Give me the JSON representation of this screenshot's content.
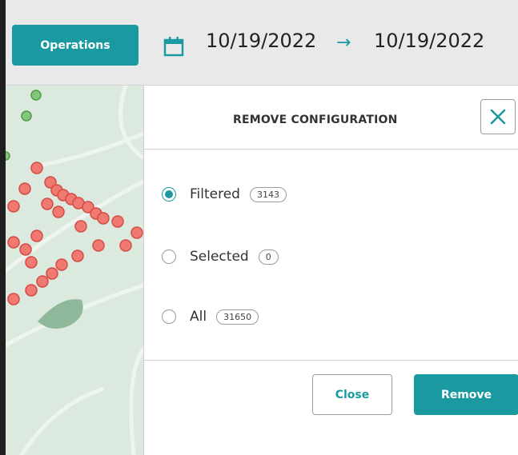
{
  "toolbar": {
    "operations_label": "Operations",
    "date_from": "10/19/2022",
    "date_arrow": "→",
    "date_to": "10/19/2022",
    "calendar_icon": "calendar-icon",
    "accent_color": "#1a9aa0"
  },
  "panel": {
    "title": "REMOVE CONFIGURATION",
    "close_icon": "close-icon",
    "options": [
      {
        "label": "Filtered",
        "count": "3143",
        "selected": true
      },
      {
        "label": "Selected",
        "count": "0",
        "selected": false
      },
      {
        "label": "All",
        "count": "31650",
        "selected": false
      }
    ],
    "close_label": "Close",
    "remove_label": "Remove"
  },
  "map": {
    "marker_colors": {
      "red": "#f07a72",
      "green": "#84c77b"
    }
  }
}
